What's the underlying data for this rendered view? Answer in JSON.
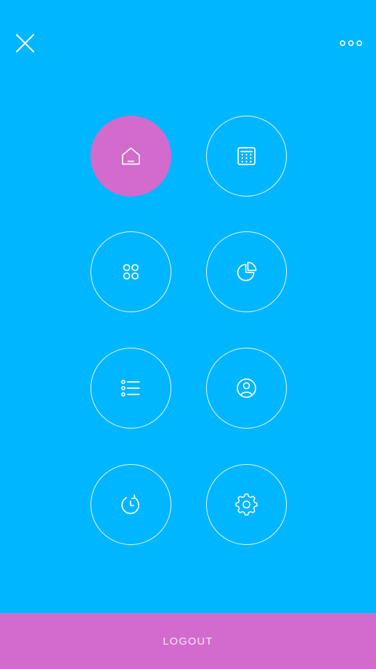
{
  "colors": {
    "background": "#00B6FF",
    "accent": "#D36BCC",
    "outline": "#FFFFFF"
  },
  "header": {
    "left_icon": "close-icon",
    "right_icon": "more-icon"
  },
  "menu": {
    "items": [
      {
        "icon": "home-icon",
        "active": true
      },
      {
        "icon": "calculator-icon",
        "active": false
      },
      {
        "icon": "apps-grid-icon",
        "active": false
      },
      {
        "icon": "pie-chart-icon",
        "active": false
      },
      {
        "icon": "list-icon",
        "active": false
      },
      {
        "icon": "profile-icon",
        "active": false
      },
      {
        "icon": "history-icon",
        "active": false
      },
      {
        "icon": "settings-icon",
        "active": false
      }
    ]
  },
  "footer": {
    "logout_label": "LOGOUT"
  }
}
